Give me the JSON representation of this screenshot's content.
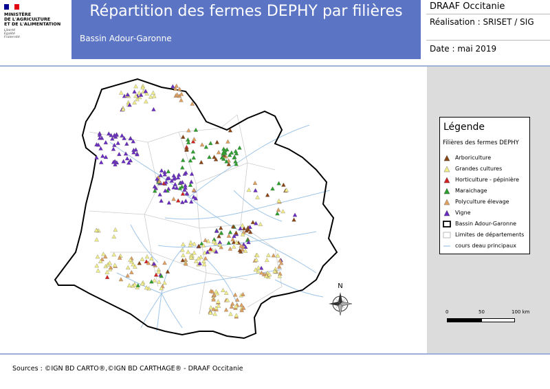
{
  "logo": {
    "ministry_lines": [
      "MINISTÈRE",
      "DE L'AGRICULTURE",
      "ET DE L'ALIMENTATION"
    ],
    "motto_lines": [
      "Liberté",
      "Égalité",
      "Fraternité"
    ]
  },
  "header": {
    "title": "Répartition des fermes DEPHY par filières",
    "subtitle": "Bassin Adour-Garonne"
  },
  "info": {
    "org": "DRAAF Occitanie",
    "realisation": "Réalisation : SRISET / SIG",
    "date": "Date : mai 2019"
  },
  "legend": {
    "title": "Légende",
    "subtitle": "Filières des fermes DEPHY",
    "items": [
      {
        "label": "Arboriculture",
        "symbol": "triangle",
        "color": "#8b4513"
      },
      {
        "label": "Grandes cultures",
        "symbol": "triangle",
        "color": "#f2ee8a"
      },
      {
        "label": "Horticulture - pépinière",
        "symbol": "triangle",
        "color": "#d62020"
      },
      {
        "label": "Maraichage",
        "symbol": "triangle",
        "color": "#2ca02c"
      },
      {
        "label": "Polyculture élevage",
        "symbol": "triangle",
        "color": "#e0a060"
      },
      {
        "label": "Vigne",
        "symbol": "triangle",
        "color": "#6a2bc2"
      },
      {
        "label": "Bassin Adour-Garonne",
        "symbol": "outline",
        "color": "#000000"
      },
      {
        "label": "Limites de départements",
        "symbol": "box",
        "color": "#bbbbbb"
      },
      {
        "label": "cours deau principaux",
        "symbol": "line",
        "color": "#9ec5e8"
      }
    ]
  },
  "scale": {
    "labels": [
      "0",
      "50",
      "100 km"
    ]
  },
  "compass": {
    "north_label": "N"
  },
  "sources": "Sources :   ©IGN BD CARTO®,©IGN BD CARTHAGE® - DRAAF Occitanie",
  "colors": {
    "header_bg": "#5b74c4",
    "panel_bg": "#dcdcdc"
  }
}
